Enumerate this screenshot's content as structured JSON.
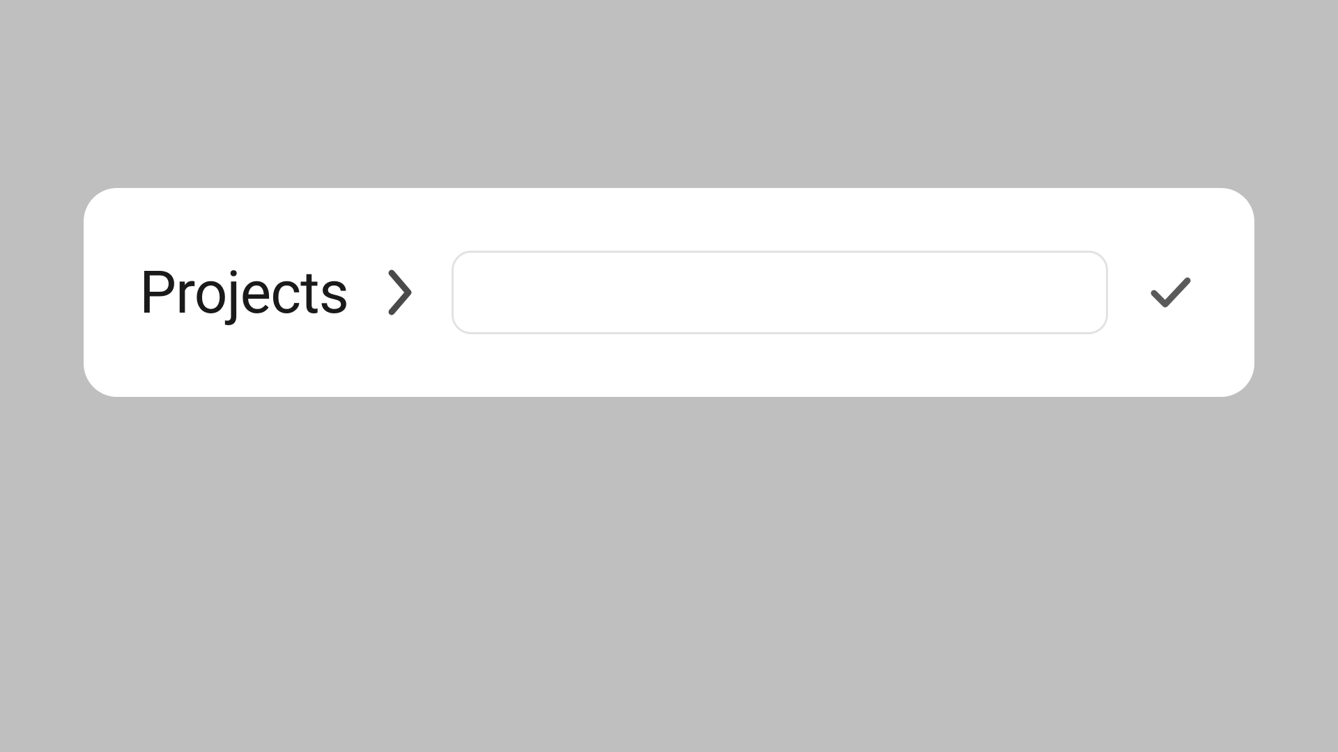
{
  "breadcrumb": {
    "parent_label": "Projects"
  },
  "input": {
    "value": "",
    "placeholder": ""
  },
  "colors": {
    "background": "#bfbfbf",
    "card_bg": "#ffffff",
    "text": "#1a1a1a",
    "chevron": "#4a4a4a",
    "check": "#5a5a5a",
    "input_border": "#e2e2e2"
  }
}
